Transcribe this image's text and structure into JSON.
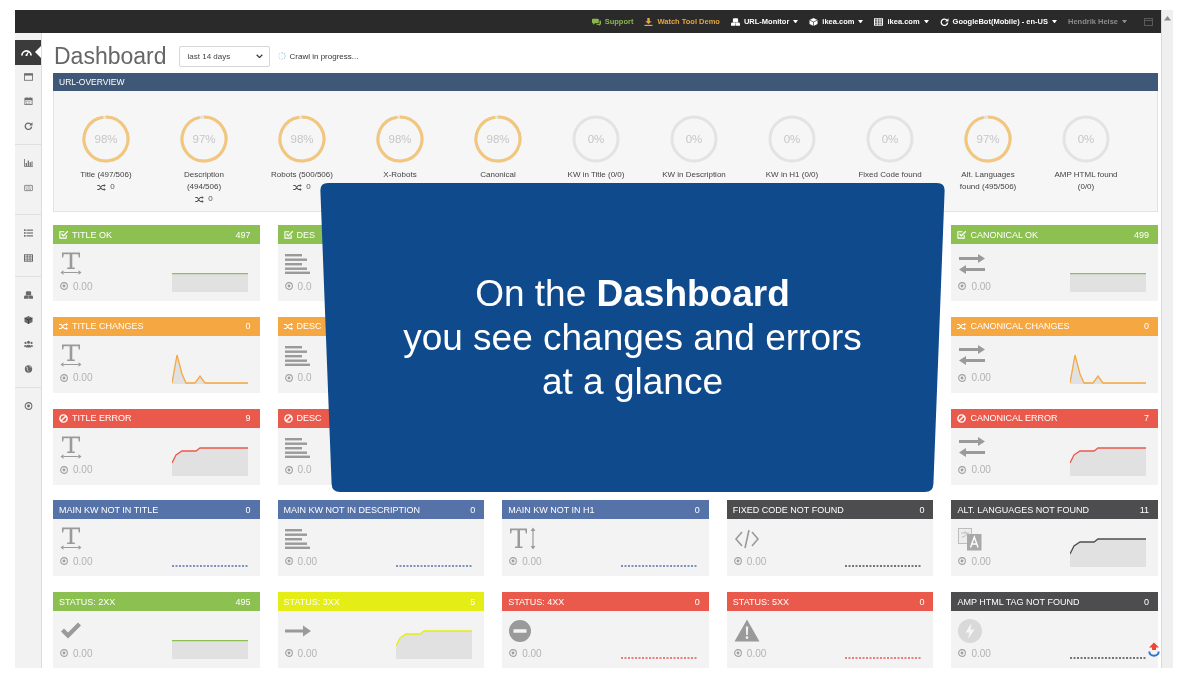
{
  "top_bar": {
    "items": [
      {
        "kind": "link",
        "label": "Support",
        "color": "#8db54b"
      },
      {
        "kind": "link",
        "label": "Watch Tool Demo",
        "color": "#e6a53d"
      },
      {
        "kind": "dropdown",
        "label": "URL-Monitor",
        "color": "#ffffff"
      },
      {
        "kind": "dropdown",
        "label": "ikea.com",
        "color": "#ffffff"
      },
      {
        "kind": "dropdown",
        "label": "ikea.com",
        "color": "#ffffff"
      },
      {
        "kind": "dropdown",
        "label": "GoogleBot(Mobile) - en-US",
        "color": "#ffffff"
      },
      {
        "kind": "dropdown",
        "label": "Hendrik Heise",
        "color": "#8c8c8c"
      }
    ]
  },
  "sidebar": {
    "groups": [
      {
        "items": [
          {
            "selected": true
          },
          {
            "selected": false
          },
          {
            "selected": false
          },
          {
            "selected": false
          }
        ]
      },
      {
        "items": [
          {
            "selected": false
          },
          {
            "selected": false
          }
        ]
      },
      {
        "items": [
          {
            "selected": false
          },
          {
            "selected": false
          }
        ]
      },
      {
        "items": [
          {
            "selected": false
          },
          {
            "selected": false
          },
          {
            "selected": false
          },
          {
            "selected": false
          }
        ]
      },
      {
        "items": [
          {
            "selected": false
          }
        ]
      }
    ]
  },
  "page_header": {
    "title": "Dashboard",
    "date_range": {
      "value": "last 14 days"
    },
    "status": "Crawl in progress..."
  },
  "url_overview": {
    "title": "URL-OVERVIEW",
    "gauges": [
      {
        "percent": "98%",
        "level": 0.98,
        "label": "Title (497/506)",
        "changes": "0"
      },
      {
        "percent": "97%",
        "level": 0.97,
        "label": "Description (494/506)",
        "changes": "0"
      },
      {
        "percent": "98%",
        "level": 0.98,
        "label": "Robots (500/506)",
        "changes": "0"
      },
      {
        "percent": "98%",
        "level": 0.98,
        "label": "X-Robots"
      },
      {
        "percent": "98%",
        "level": 0.98,
        "label": "Canonical"
      },
      {
        "percent": "0%",
        "label": "KW in Title (0/0)"
      },
      {
        "percent": "0%",
        "label": "KW in Description"
      },
      {
        "percent": "0%",
        "label": "KW in H1 (0/0)"
      },
      {
        "percent": "0%",
        "label": "Fixed Code found"
      },
      {
        "percent": "97%",
        "level": 0.97,
        "label": "Alt. Languages found (495/506)"
      },
      {
        "percent": "0%",
        "label": "AMP HTML found (0/0)"
      }
    ]
  },
  "card_columns": [
    {
      "cards": [
        {
          "kind": "ok",
          "color": "#8cc152",
          "title": "TITLE OK",
          "count": "497",
          "value": "0.00",
          "sparkline": {
            "kind": "flat-high"
          }
        },
        {
          "kind": "changes",
          "color": "#f5a742",
          "title": "TITLE CHANGES",
          "count": "0",
          "value": "0.00",
          "sparkline": {
            "kind": "spikes"
          }
        },
        {
          "kind": "error",
          "color": "#ea5a4c",
          "title": "TITLE ERROR",
          "count": "9",
          "value": "0.00",
          "sparkline": {
            "kind": "rising"
          }
        },
        {
          "kind": "plain",
          "color": "#5673a9",
          "title": "MAIN KW NOT IN TITLE",
          "count": "0",
          "value": "0.00",
          "sparkline": {
            "kind": "flat-zero"
          }
        },
        {
          "kind": "plain",
          "color": "#8cc152",
          "title": "STATUS: 2XX",
          "count": "495",
          "value": "0.00",
          "sparkline": {
            "kind": "flat-high"
          }
        }
      ]
    },
    {
      "cards": [
        {
          "kind": "ok",
          "color": "#8cc152",
          "title": "DES",
          "value": "0.0"
        },
        {
          "kind": "changes",
          "color": "#f5a742",
          "title": "DESC",
          "value": "0.0"
        },
        {
          "kind": "error",
          "color": "#ea5a4c",
          "title": "DESC",
          "value": "0.0"
        },
        {
          "kind": "plain",
          "color": "#5673a9",
          "title": "MAIN KW NOT IN DESCRIPTION",
          "count": "0",
          "value": "0.00",
          "sparkline": {
            "kind": "flat-zero"
          }
        },
        {
          "kind": "plain",
          "color": "#e4ee16",
          "title": "STATUS: 3XX",
          "count": "5",
          "value": "0.00",
          "sparkline": {
            "kind": "rising"
          }
        }
      ]
    },
    {
      "cards": [
        {
          "kind": "plain",
          "color": "#5673a9",
          "title": "MAIN KW NOT IN H1",
          "count": "0",
          "value": "0.00",
          "sparkline": {
            "kind": "flat-zero"
          }
        },
        {
          "kind": "plain",
          "color": "#ea5a4c",
          "title": "STATUS: 4XX",
          "count": "0",
          "value": "0.00",
          "sparkline": {
            "kind": "flat-zero"
          }
        }
      ]
    },
    {
      "cards": [
        {
          "kind": "plain",
          "color": "#4d4d4f",
          "title": "FIXED CODE NOT FOUND",
          "count": "0",
          "value": "0.00",
          "sparkline": {
            "kind": "flat-zero"
          }
        },
        {
          "kind": "plain",
          "color": "#ea5a4c",
          "title": "STATUS: 5XX",
          "count": "0",
          "value": "0.00",
          "sparkline": {
            "kind": "flat-zero"
          }
        }
      ]
    },
    {
      "cards": [
        {
          "kind": "ok",
          "color": "#8cc152",
          "title": "CANONICAL OK",
          "count": "499",
          "value": "0.00",
          "sparkline": {
            "kind": "flat-high"
          }
        },
        {
          "kind": "changes",
          "color": "#f5a742",
          "title": "CANONICAL CHANGES",
          "count": "0",
          "value": "0.00",
          "sparkline": {
            "kind": "spikes"
          }
        },
        {
          "kind": "error",
          "color": "#ea5a4c",
          "title": "CANONICAL ERROR",
          "count": "7",
          "value": "0.00",
          "sparkline": {
            "kind": "rising"
          }
        },
        {
          "kind": "plain",
          "color": "#4d4d4f",
          "title": "ALT. LANGUAGES NOT FOUND",
          "count": "11",
          "value": "0.00",
          "sparkline": {
            "kind": "rising"
          }
        },
        {
          "kind": "plain",
          "color": "#4d4d4f",
          "title": "AMP HTML TAG NOT FOUND",
          "count": "0",
          "value": "0.00",
          "sparkline": {
            "kind": "flat-zero"
          }
        }
      ]
    }
  ],
  "callout": {
    "lines": [
      "On the **Dashboard**",
      "you see changes and errors",
      "at a glance"
    ]
  }
}
